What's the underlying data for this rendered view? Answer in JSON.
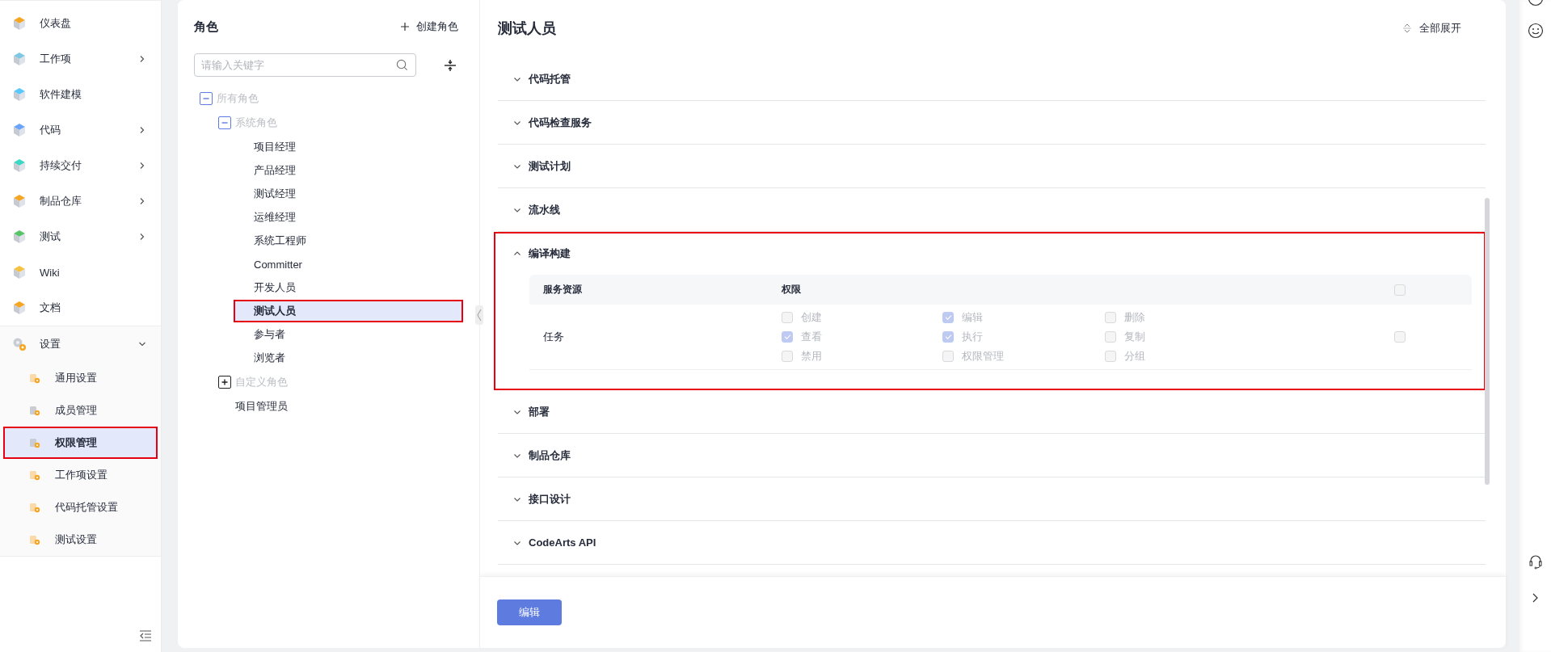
{
  "sidebar": {
    "items": [
      {
        "label": "仪表盘"
      },
      {
        "label": "工作项",
        "expanded": false
      },
      {
        "label": "软件建模"
      },
      {
        "label": "代码",
        "expanded": false
      },
      {
        "label": "持续交付",
        "expanded": false
      },
      {
        "label": "制品仓库",
        "expanded": false
      },
      {
        "label": "测试",
        "expanded": false
      },
      {
        "label": "Wiki"
      },
      {
        "label": "文档"
      },
      {
        "label": "设置",
        "expanded": true,
        "children": [
          {
            "label": "通用设置",
            "selected": false,
            "annotated": false
          },
          {
            "label": "成员管理",
            "selected": false,
            "annotated": false
          },
          {
            "label": "权限管理",
            "selected": true,
            "annotated": true
          },
          {
            "label": "工作项设置",
            "selected": false,
            "annotated": false
          },
          {
            "label": "代码托管设置",
            "selected": false,
            "annotated": false
          },
          {
            "label": "测试设置",
            "selected": false,
            "annotated": false
          }
        ]
      }
    ]
  },
  "roles": {
    "title": "角色",
    "create_button": "创建角色",
    "search": {
      "placeholder": "请输入关键字"
    },
    "tree": [
      {
        "label": "所有角色",
        "expanded": true,
        "children": [
          {
            "label": "系统角色",
            "expanded": true,
            "children": [
              {
                "label": "项目经理",
                "selected": false,
                "annotated": false
              },
              {
                "label": "产品经理",
                "selected": false,
                "annotated": false
              },
              {
                "label": "测试经理",
                "selected": false,
                "annotated": false
              },
              {
                "label": "运维经理",
                "selected": false,
                "annotated": false
              },
              {
                "label": "系统工程师",
                "selected": false,
                "annotated": false
              },
              {
                "label": "Committer",
                "selected": false,
                "annotated": false
              },
              {
                "label": "开发人员",
                "selected": false,
                "annotated": false
              },
              {
                "label": "测试人员",
                "selected": true,
                "annotated": true
              },
              {
                "label": "参与者",
                "selected": false,
                "annotated": false
              },
              {
                "label": "浏览者",
                "selected": false,
                "annotated": false
              }
            ]
          },
          {
            "label": "自定义角色",
            "expanded": false
          },
          {
            "label": "项目管理员",
            "selected": false,
            "annotated": false
          }
        ]
      }
    ]
  },
  "detail": {
    "title": "测试人员",
    "expand_all": "全部展开",
    "sections": [
      {
        "title": "代码托管",
        "expanded": false,
        "annotated": false
      },
      {
        "title": "代码检查服务",
        "expanded": false,
        "annotated": false
      },
      {
        "title": "测试计划",
        "expanded": false,
        "annotated": false
      },
      {
        "title": "流水线",
        "expanded": false,
        "annotated": false
      },
      {
        "title": "编译构建",
        "expanded": true,
        "annotated": true,
        "table": {
          "columns": [
            "服务资源",
            "权限"
          ],
          "select_all": {
            "checked": false,
            "disabled": true
          },
          "rows": [
            {
              "resource": "任务",
              "select_all": {
                "checked": false,
                "disabled": true
              },
              "permissions": [
                {
                  "label": "创建",
                  "checked": false,
                  "disabled": true
                },
                {
                  "label": "编辑",
                  "checked": true,
                  "disabled": true
                },
                {
                  "label": "删除",
                  "checked": false,
                  "disabled": true
                },
                {
                  "label": "查看",
                  "checked": true,
                  "disabled": true
                },
                {
                  "label": "执行",
                  "checked": true,
                  "disabled": true
                },
                {
                  "label": "复制",
                  "checked": false,
                  "disabled": true
                },
                {
                  "label": "禁用",
                  "checked": false,
                  "disabled": true
                },
                {
                  "label": "权限管理",
                  "checked": false,
                  "disabled": true
                },
                {
                  "label": "分组",
                  "checked": false,
                  "disabled": true
                }
              ]
            }
          ]
        }
      },
      {
        "title": "部署",
        "expanded": false,
        "annotated": false
      },
      {
        "title": "制品仓库",
        "expanded": false,
        "annotated": false
      },
      {
        "title": "接口设计",
        "expanded": false,
        "annotated": false
      },
      {
        "title": "CodeArts API",
        "expanded": false,
        "annotated": false
      }
    ],
    "edit_button": "编辑"
  }
}
